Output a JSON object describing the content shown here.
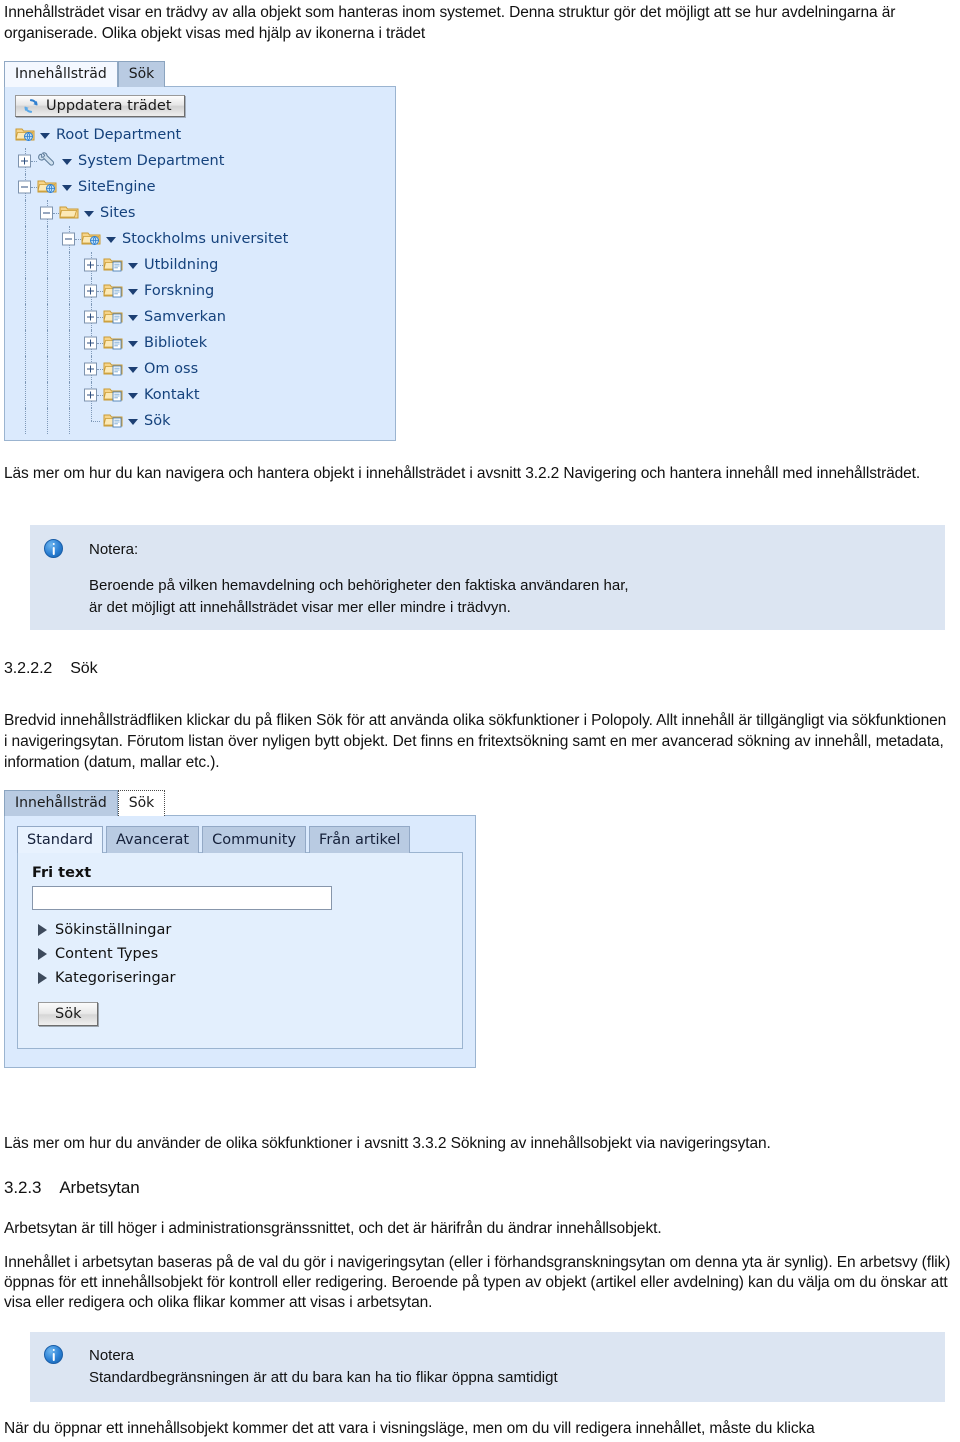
{
  "intro_paragraph": "Innehållsträdet visar en trädvy av alla objekt som hanteras inom systemet. Denna struktur gör det möjligt att se hur avdelningarna är organiserade. Olika objekt visas med hjälp av ikonerna i trädet",
  "tree_widget": {
    "tabs": [
      {
        "label": "Innehållsträd",
        "active": true
      },
      {
        "label": "Sök",
        "active": false
      }
    ],
    "refresh_button": "Uppdatera trädet",
    "nodes": [
      {
        "label": "Root Department",
        "depth": 0,
        "icon": "folder-globe-icon",
        "expander": "none"
      },
      {
        "label": "System Department",
        "depth": 1,
        "icon": "wrench-icon",
        "expander": "plus"
      },
      {
        "label": "SiteEngine",
        "depth": 1,
        "icon": "folder-globe-icon",
        "expander": "minus"
      },
      {
        "label": "Sites",
        "depth": 2,
        "icon": "folder-icon",
        "expander": "minus"
      },
      {
        "label": "Stockholms universitet",
        "depth": 3,
        "icon": "folder-globe-icon",
        "expander": "minus"
      },
      {
        "label": "Utbildning",
        "depth": 4,
        "icon": "folder-page-icon",
        "expander": "plus"
      },
      {
        "label": "Forskning",
        "depth": 4,
        "icon": "folder-page-icon",
        "expander": "plus"
      },
      {
        "label": "Samverkan",
        "depth": 4,
        "icon": "folder-page-icon",
        "expander": "plus"
      },
      {
        "label": "Bibliotek",
        "depth": 4,
        "icon": "folder-page-icon",
        "expander": "plus"
      },
      {
        "label": "Om oss",
        "depth": 4,
        "icon": "folder-page-icon",
        "expander": "plus"
      },
      {
        "label": "Kontakt",
        "depth": 4,
        "icon": "folder-page-icon",
        "expander": "plus"
      },
      {
        "label": "Sök",
        "depth": 4,
        "icon": "folder-page-icon",
        "expander": "leaf"
      }
    ]
  },
  "paragraph_after_tree": "Läs mer om hur du kan navigera och hantera objekt i innehållsträdet i avsnitt 3.2.2 Navigering och hantera innehåll med innehållsträdet.",
  "note_1": {
    "title": "Notera:",
    "body_line_1": "Beroende på vilken hemavdelning och behörigheter den faktiska användaren har,",
    "body_line_2": "är det möjligt att innehållsträdet visar mer eller mindre i trädvyn."
  },
  "section_3222": {
    "number": "3.2.2.2",
    "title": "Sök",
    "paragraph": "Bredvid innehållsträdfliken klickar du på fliken Sök för att använda olika sökfunktioner i Polopoly. Allt innehåll är tillgängligt via sökfunktionen i navigeringsytan. Förutom listan över nyligen bytt objekt. Det finns en fritextsökning samt en mer avancerad sökning av innehåll, metadata, information (datum, mallar etc.)."
  },
  "search_widget": {
    "tabs": [
      {
        "label": "Innehållsträd",
        "active": false
      },
      {
        "label": "Sök",
        "active": true
      }
    ],
    "inner_tabs": [
      {
        "label": "Standard",
        "active": true
      },
      {
        "label": "Avancerat",
        "active": false
      },
      {
        "label": "Community",
        "active": false
      },
      {
        "label": "Från artikel",
        "active": false
      }
    ],
    "free_text_label": "Fri text",
    "free_text_value": "",
    "free_text_placeholder": "",
    "collapsibles": [
      "Sökinställningar",
      "Content Types",
      "Kategoriseringar"
    ],
    "submit_button": "Sök"
  },
  "paragraph_after_search": "Läs mer om hur du använder de olika sökfunktioner i avsnitt 3.3.2 Sökning av innehållsobjekt via navigeringsytan.",
  "section_323": {
    "number": "3.2.3",
    "title": "Arbetsytan",
    "paragraph_1": "Arbetsytan är till höger i administrationsgränssnittet, och det är härifrån du ändrar innehållsobjekt.",
    "paragraph_2": "Innehållet i arbetsytan baseras på de val du gör i navigeringsytan (eller i förhandsgranskningsytan om denna yta är synlig). En arbetsvy (flik) öppnas för ett innehållsobjekt för kontroll eller redigering. Beroende på typen av objekt (artikel eller avdelning) kan du välja om du önskar att visa eller redigera och olika flikar kommer att visas i arbetsytan."
  },
  "note_2": {
    "title": "Notera",
    "body_line_1": "Standardbegränsningen är att du bara kan ha tio flikar öppna samtidigt"
  },
  "closing_paragraph": "När du öppnar ett innehållsobjekt kommer det att vara i visningsläge, men om du vill redigera innehållet, måste du klicka",
  "colors": {
    "tree_panel_bg": "#dbeafd",
    "note_bg": "#dce5f2",
    "tab_inactive": "#b9cbe2",
    "tab_active": "#f4f8ff",
    "node_text": "#15427c",
    "info_icon": "#2a7fd4"
  }
}
